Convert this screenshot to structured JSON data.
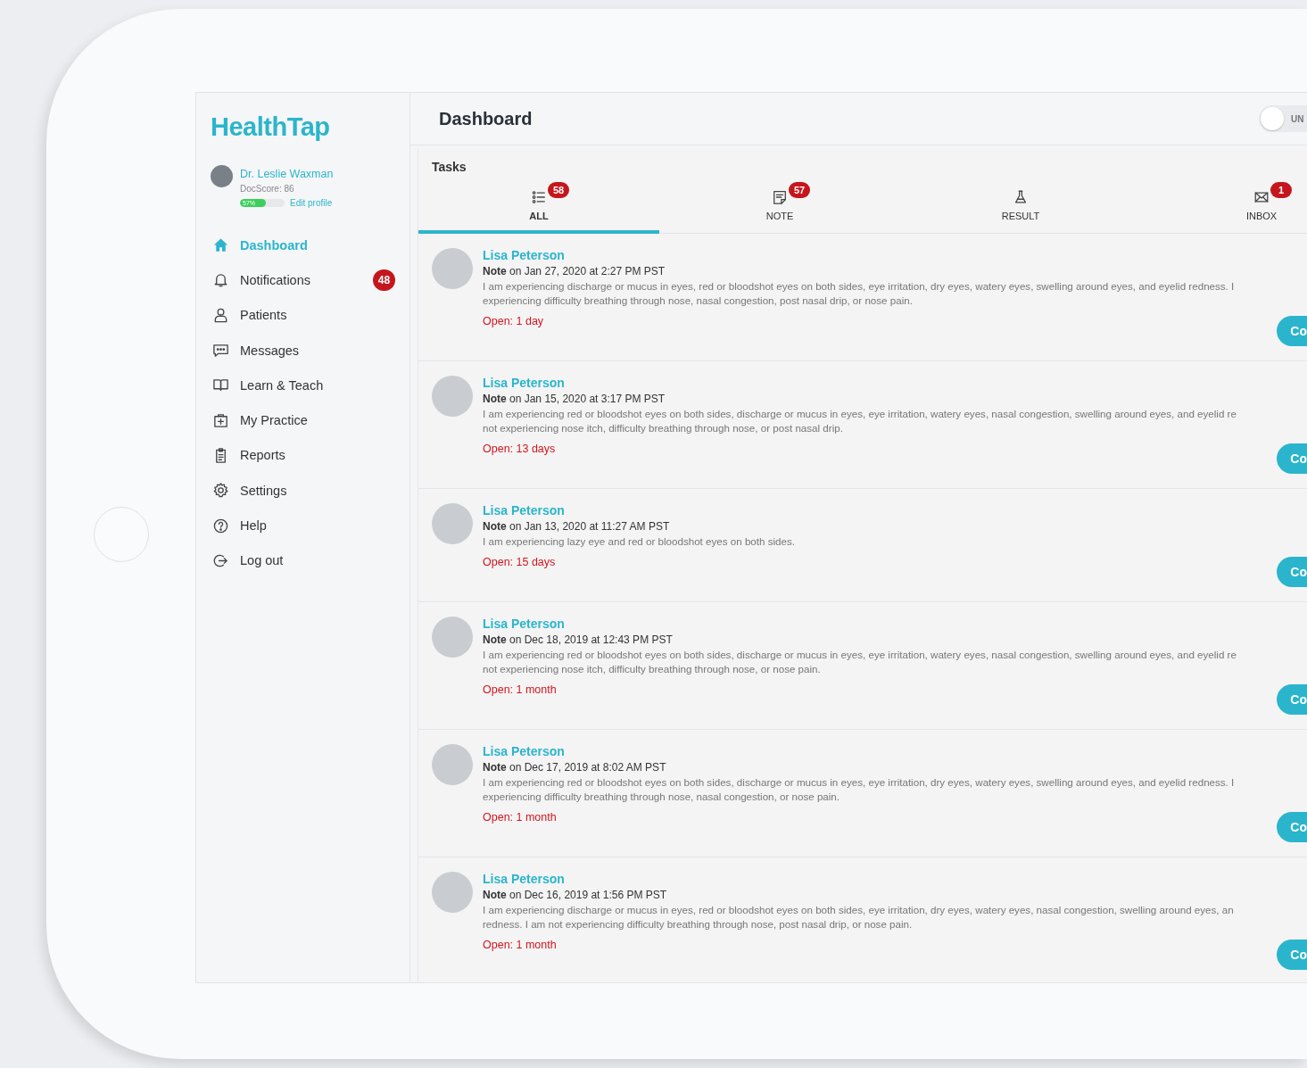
{
  "sidebar": {
    "logo": "HealthTap",
    "profile": {
      "name": "Dr. Leslie Waxman",
      "docscore": "DocScore: 86",
      "completion": {
        "level": 0.57,
        "label": "57%"
      },
      "edit_link": "Edit profile"
    },
    "items": [
      {
        "kind": "home",
        "label": "Dashboard",
        "selected": true
      },
      {
        "kind": "bell",
        "label": "Notifications",
        "selected": false,
        "badge": "48"
      },
      {
        "kind": "person",
        "label": "Patients",
        "selected": false
      },
      {
        "kind": "chat",
        "label": "Messages",
        "selected": false
      },
      {
        "kind": "book",
        "label": "Learn & Teach",
        "selected": false
      },
      {
        "kind": "kit",
        "label": "My Practice",
        "selected": false
      },
      {
        "kind": "clipboard",
        "label": "Reports",
        "selected": false
      },
      {
        "kind": "gear",
        "label": "Settings",
        "selected": false
      },
      {
        "kind": "help",
        "label": "Help",
        "selected": false
      },
      {
        "kind": "logout",
        "label": "Log out",
        "selected": false
      }
    ]
  },
  "header": {
    "title": "Dashboard",
    "toggle": {
      "on": false,
      "label": "UN"
    }
  },
  "tasks": {
    "title": "Tasks",
    "tabs": [
      {
        "kind": "list",
        "label": "ALL",
        "badge": "58",
        "selected": true
      },
      {
        "kind": "note",
        "label": "NOTE",
        "badge": "57",
        "selected": false
      },
      {
        "kind": "flask",
        "label": "RESULT",
        "selected": false
      },
      {
        "kind": "mail",
        "label": "INBOX",
        "badge": "1",
        "selected": false
      }
    ],
    "items": [
      {
        "patient": "Lisa Peterson",
        "type": "Note",
        "date": "on Jan 27, 2020 at 2:27 PM PST",
        "lines": [
          "I am experiencing discharge or mucus in eyes, red or bloodshot eyes on both sides, eye irritation, dry eyes, watery eyes, swelling around eyes, and eyelid redness. I",
          "experiencing difficulty breathing through nose, nasal congestion, post nasal drip, or nose pain."
        ],
        "open": "Open: 1 day",
        "button": "Co"
      },
      {
        "patient": "Lisa Peterson",
        "type": "Note",
        "date": "on Jan 15, 2020 at 3:17 PM PST",
        "lines": [
          "I am experiencing red or bloodshot eyes on both sides, discharge or mucus in eyes, eye irritation, watery eyes, nasal congestion, swelling around eyes, and eyelid re",
          "not experiencing nose itch, difficulty breathing through nose, or post nasal drip."
        ],
        "open": "Open: 13 days",
        "button": "Co"
      },
      {
        "patient": "Lisa Peterson",
        "type": "Note",
        "date": "on Jan 13, 2020 at 11:27 AM PST",
        "lines": [
          "I am experiencing lazy eye and red or bloodshot eyes on both sides."
        ],
        "open": "Open: 15 days",
        "button": "Co"
      },
      {
        "patient": "Lisa Peterson",
        "type": "Note",
        "date": "on Dec 18, 2019 at 12:43 PM PST",
        "lines": [
          "I am experiencing red or bloodshot eyes on both sides, discharge or mucus in eyes, eye irritation, watery eyes, nasal congestion, swelling around eyes, and eyelid re",
          "not experiencing nose itch, difficulty breathing through nose, or nose pain."
        ],
        "open": "Open: 1 month",
        "button": "Co"
      },
      {
        "patient": "Lisa Peterson",
        "type": "Note",
        "date": "on Dec 17, 2019 at 8:02 AM PST",
        "lines": [
          "I am experiencing red or bloodshot eyes on both sides, discharge or mucus in eyes, eye irritation, dry eyes, watery eyes, swelling around eyes, and eyelid redness. I",
          "experiencing difficulty breathing through nose, nasal congestion, or nose pain."
        ],
        "open": "Open: 1 month",
        "button": "Co"
      },
      {
        "patient": "Lisa Peterson",
        "type": "Note",
        "date": "on Dec 16, 2019 at 1:56 PM PST",
        "lines": [
          "I am experiencing discharge or mucus in eyes, red or bloodshot eyes on both sides, eye irritation, dry eyes, watery eyes, nasal congestion, swelling around eyes, an",
          "redness. I am not experiencing difficulty breathing through nose, post nasal drip, or nose pain."
        ],
        "open": "Open: 1 month",
        "button": "Co"
      }
    ]
  }
}
